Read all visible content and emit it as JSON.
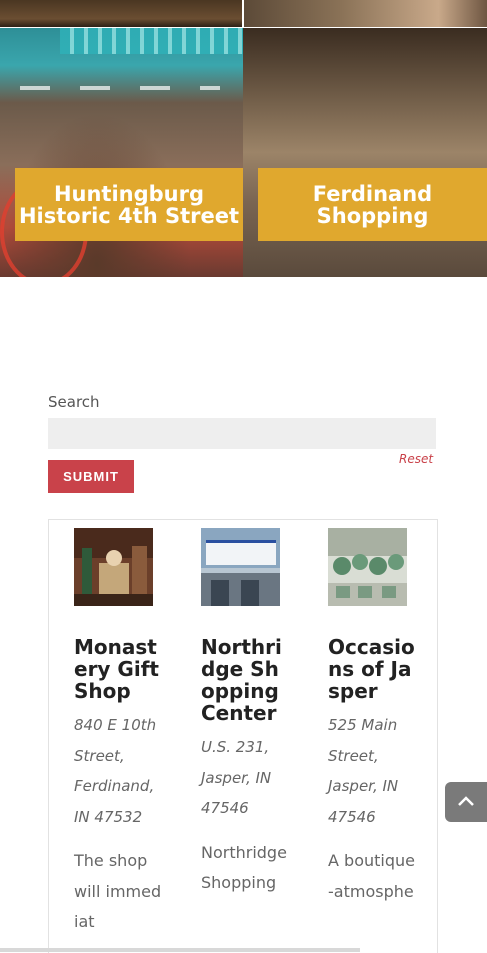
{
  "tiles": [
    {
      "title": "Huntingburg Historic 4th Street"
    },
    {
      "title": "Ferdinand Shopping"
    }
  ],
  "search": {
    "title": "Search",
    "value": "",
    "placeholder": "",
    "submit_label": "SUBMIT",
    "reset_label": "Reset"
  },
  "results": [
    {
      "name": "Monastery Gift Shop",
      "address": "840 E 10th Street, Ferdinand, IN 47532",
      "description": "The shop will immediat"
    },
    {
      "name": "Northridge Shopping Center",
      "address": "U.S. 231, Jasper, IN 47546",
      "description": "Northridge Shopping"
    },
    {
      "name": "Occasions of Jasper",
      "address": "525 Main Street, Jasper, IN 47546",
      "description": "A boutique-atmosphe"
    }
  ],
  "colors": {
    "accent_gold": "#e0a82e",
    "submit_red": "#c9424a",
    "reset_red": "#c9424a",
    "back_to_top_bg": "#7a7a7a"
  },
  "icons": {
    "back_to_top": "chevron-up-icon"
  }
}
